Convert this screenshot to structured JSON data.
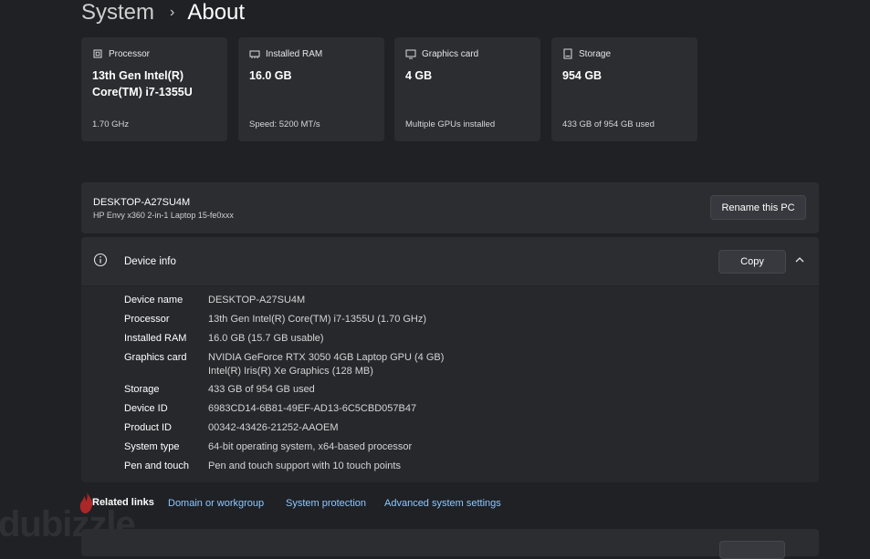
{
  "breadcrumb": {
    "parent": "System",
    "separator": "›",
    "current": "About"
  },
  "specs": [
    {
      "icon": "processor-icon",
      "label": "Processor",
      "value_line1": "13th Gen Intel(R)",
      "value_line2": "Core(TM) i7-1355U",
      "sub": "1.70 GHz"
    },
    {
      "icon": "ram-icon",
      "label": "Installed RAM",
      "value_line1": "16.0 GB",
      "value_line2": "",
      "sub": "Speed: 5200 MT/s"
    },
    {
      "icon": "graphics-card-icon",
      "label": "Graphics card",
      "value_line1": "4 GB",
      "value_line2": "",
      "sub": "Multiple GPUs installed"
    },
    {
      "icon": "storage-icon",
      "label": "Storage",
      "value_line1": "954 GB",
      "value_line2": "",
      "sub": "433 GB of 954 GB used"
    }
  ],
  "pc": {
    "name": "DESKTOP-A27SU4M",
    "model": "HP Envy x360 2-in-1 Laptop 15-fe0xxx",
    "rename_label": "Rename this PC"
  },
  "device_info": {
    "title": "Device info",
    "copy_label": "Copy",
    "rows": [
      {
        "label": "Device name",
        "value": "DESKTOP-A27SU4M"
      },
      {
        "label": "Processor",
        "value": "13th Gen Intel(R) Core(TM) i7-1355U (1.70 GHz)"
      },
      {
        "label": "Installed RAM",
        "value": "16.0 GB (15.7 GB usable)"
      },
      {
        "label": "Graphics card",
        "value": "NVIDIA GeForce RTX 3050 4GB Laptop GPU (4 GB)",
        "value2": "Intel(R) Iris(R) Xe Graphics (128 MB)"
      },
      {
        "label": "Storage",
        "value": "433 GB of 954 GB used"
      },
      {
        "label": "Device ID",
        "value": "6983CD14-6B81-49EF-AD13-6C5CBD057B47"
      },
      {
        "label": "Product ID",
        "value": "00342-43426-21252-AAOEM"
      },
      {
        "label": "System type",
        "value": "64-bit operating system, x64-based processor"
      },
      {
        "label": "Pen and touch",
        "value": "Pen and touch support with 10 touch points"
      }
    ]
  },
  "related": {
    "label": "Related links",
    "links": [
      "Domain or workgroup",
      "System protection",
      "Advanced system settings"
    ]
  },
  "watermark": "dubizzle",
  "colors": {
    "background": "#1f2125",
    "card": "#2b2d31",
    "link": "#8ec8ff"
  }
}
